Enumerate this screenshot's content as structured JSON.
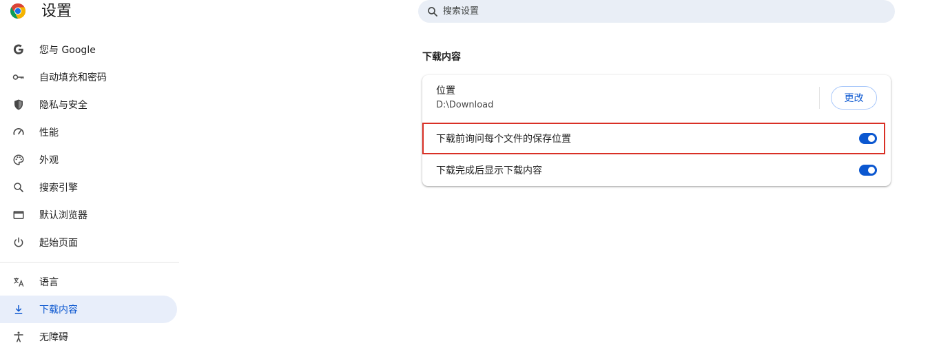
{
  "header": {
    "title": "设置",
    "logo_icon": "chrome-logo-icon"
  },
  "search": {
    "placeholder": "搜索设置",
    "icon": "search-icon"
  },
  "sidebar": {
    "items": [
      {
        "label": "您与 Google",
        "icon": "google-g-icon",
        "active": false
      },
      {
        "label": "自动填充和密码",
        "icon": "key-icon",
        "active": false
      },
      {
        "label": "隐私与安全",
        "icon": "shield-icon",
        "active": false
      },
      {
        "label": "性能",
        "icon": "speedometer-icon",
        "active": false
      },
      {
        "label": "外观",
        "icon": "palette-icon",
        "active": false
      },
      {
        "label": "搜索引擎",
        "icon": "search-icon",
        "active": false
      },
      {
        "label": "默认浏览器",
        "icon": "browser-window-icon",
        "active": false
      },
      {
        "label": "起始页面",
        "icon": "power-icon",
        "active": false
      },
      {
        "label": "语言",
        "icon": "translate-icon",
        "active": false
      },
      {
        "label": "下载内容",
        "icon": "download-icon",
        "active": true
      },
      {
        "label": "无障碍",
        "icon": "accessibility-icon",
        "active": false
      }
    ]
  },
  "main": {
    "section_title": "下载内容",
    "location": {
      "label": "位置",
      "path": "D:\\Download",
      "change_button": "更改"
    },
    "ask_where": {
      "label": "下载前询问每个文件的保存位置",
      "enabled": true
    },
    "show_when_done": {
      "label": "下载完成后显示下载内容",
      "enabled": true
    }
  },
  "colors": {
    "accent": "#0b57d0",
    "active_nav_bg": "#e8eefa",
    "search_bg": "#e9eef6",
    "highlight": "#d93025"
  }
}
